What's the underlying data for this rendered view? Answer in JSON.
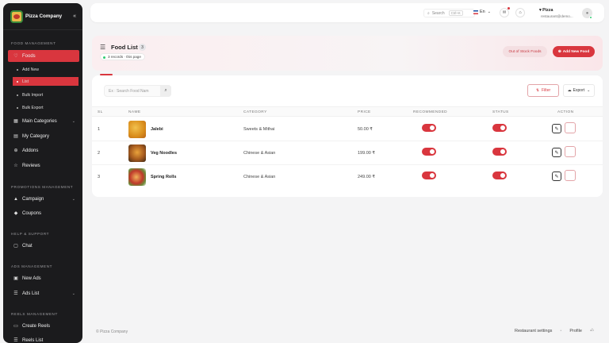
{
  "brand": {
    "name": "Pizza Company"
  },
  "sidebar": {
    "sections": {
      "food": "FOOD MANAGEMENT",
      "promotions": "PROMOTIONS MANAGEMENT",
      "help": "HELP & SUPPORT",
      "ads": "ADS MANAGEMENT",
      "reels": "REELS MANAGEMENT"
    },
    "items": {
      "foods": "Foods",
      "add_new": "Add New",
      "list": "List",
      "bulk_import": "Bulk Import",
      "bulk_export": "Bulk Export",
      "main_categories": "Main Categories",
      "my_category": "My Category",
      "addons": "Addons",
      "reviews": "Reviews",
      "campaign": "Campaign",
      "coupons": "Coupons",
      "chat": "Chat",
      "new_ads": "New Ads",
      "ads_list": "Ads List",
      "create_reels": "Create Reels",
      "reels_list": "Reels List"
    }
  },
  "topbar": {
    "search_placeholder": "Search",
    "search_shortcut": "Ctrl+K",
    "language": "En",
    "user_name": "Pizza",
    "user_email": "restaurant@demo..."
  },
  "header": {
    "title": "Food List",
    "count": "3",
    "records": "3 records · this page",
    "out_of_stock": "Out of Stock Foods",
    "add_new": "Add New Food"
  },
  "toolbar": {
    "search_placeholder": "Ex : Search Food Nam",
    "filter": "Filter",
    "export": "Export"
  },
  "table": {
    "columns": {
      "sl": "SL",
      "name": "NAME",
      "category": "CATEGORY",
      "price": "PRICE",
      "recommended": "RECOMMENDED",
      "status": "STATUS",
      "action": "ACTION"
    },
    "rows": [
      {
        "sl": "1",
        "name": "Jalebi",
        "category": "Sweets & Mithai",
        "price": "50.00 ₹",
        "recommended": true,
        "status": true
      },
      {
        "sl": "2",
        "name": "Veg Noodles",
        "category": "Chinese & Asian",
        "price": "199.00 ₹",
        "recommended": true,
        "status": true
      },
      {
        "sl": "3",
        "name": "Spring Rolls",
        "category": "Chinese & Asian",
        "price": "249.00 ₹",
        "recommended": true,
        "status": true
      }
    ]
  },
  "footer": {
    "copyright": "© Pizza Company",
    "restaurant_settings": "Restaurant settings",
    "profile": "Profile"
  },
  "colors": {
    "accent": "#d9363e",
    "sidebar": "#1b1b1d"
  }
}
